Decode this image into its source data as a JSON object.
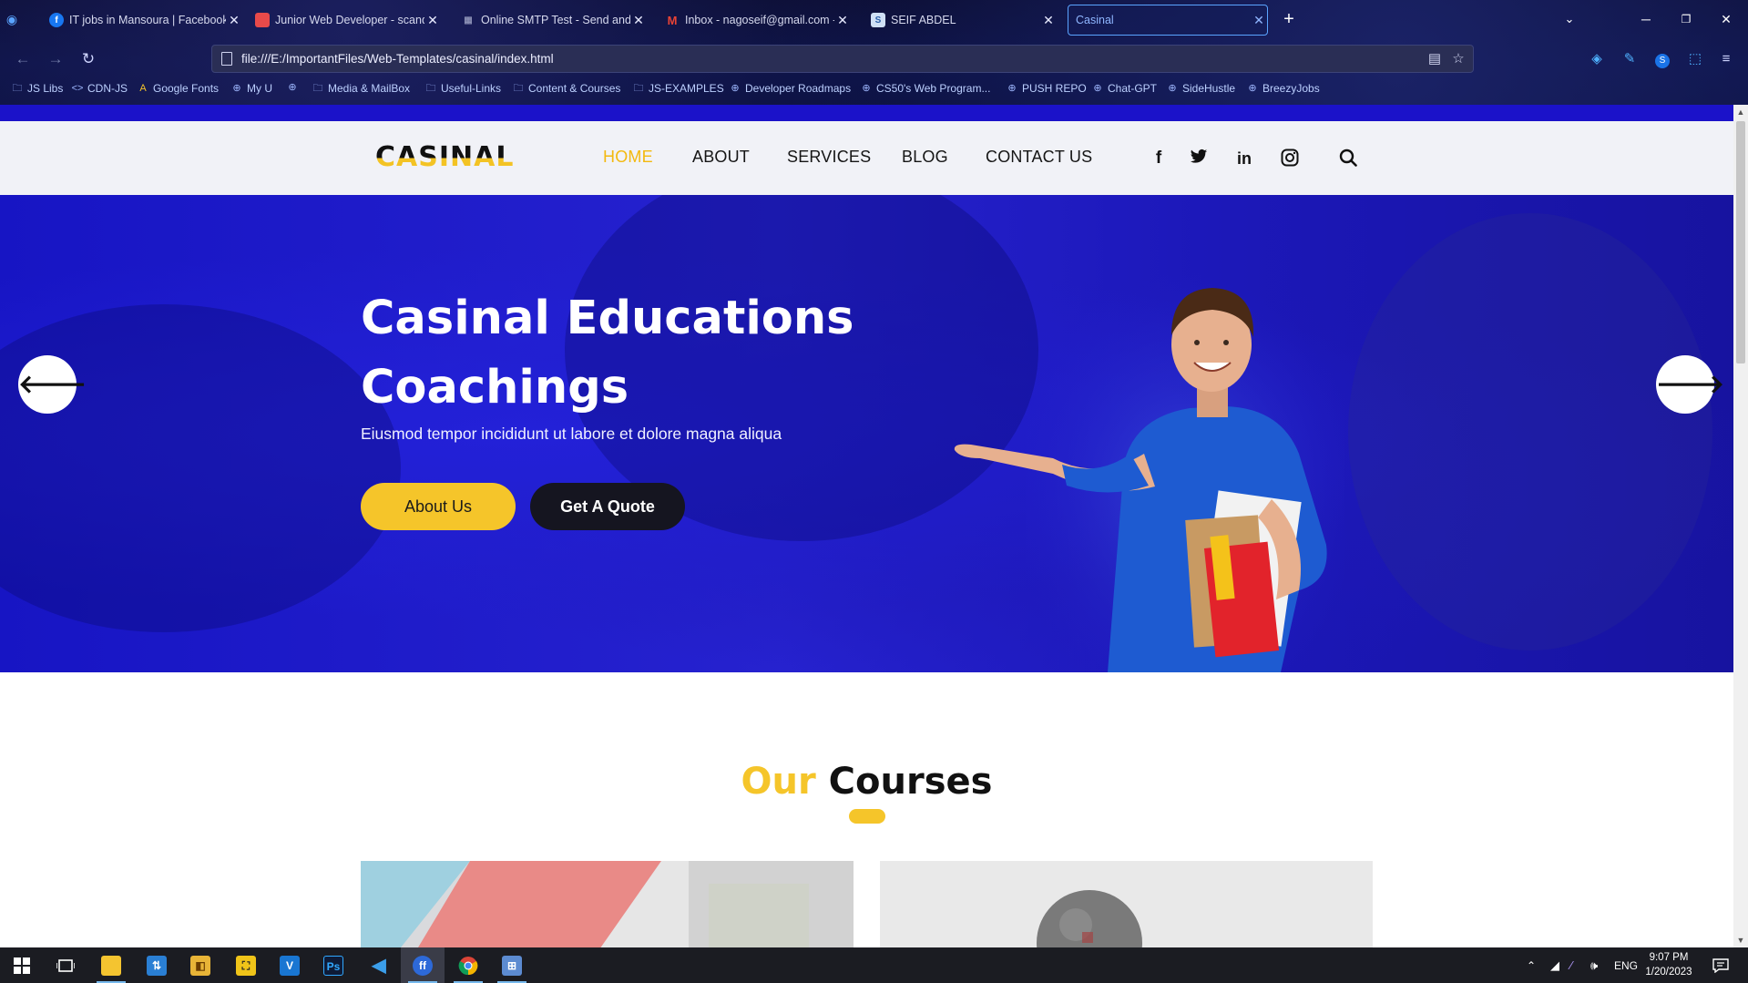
{
  "browser": {
    "tabs": [
      {
        "title": "IT jobs in Mansoura | Facebook",
        "favicon": "facebook-icon"
      },
      {
        "title": "Junior Web Developer - scandiweb",
        "favicon": "scandiweb-icon"
      },
      {
        "title": "Online SMTP Test - Send and Check",
        "favicon": "grid-icon"
      },
      {
        "title": "Inbox - nagoseif@gmail.com - Gmail",
        "favicon": "gmail-icon"
      },
      {
        "title": "SEIF ABDEL",
        "favicon": "page-icon"
      },
      {
        "title": "Casinal",
        "favicon": "none",
        "active": true
      }
    ],
    "url": "file:///E:/ImportantFiles/Web-Templates/casinal/index.html",
    "bookmarks": [
      {
        "label": "JS Libs",
        "icon": "folder-icon"
      },
      {
        "label": "CDN-JS",
        "icon": "code-icon"
      },
      {
        "label": "Google Fonts",
        "icon": "google-fonts-icon"
      },
      {
        "label": "My U",
        "icon": "globe-icon"
      },
      {
        "label": "",
        "icon": "globe-icon"
      },
      {
        "label": "Media & MailBox",
        "icon": "folder-icon"
      },
      {
        "label": "Useful-Links",
        "icon": "folder-icon"
      },
      {
        "label": "Content & Courses",
        "icon": "folder-icon"
      },
      {
        "label": "JS-EXAMPLES",
        "icon": "folder-icon"
      },
      {
        "label": "Developer Roadmaps",
        "icon": "globe-icon"
      },
      {
        "label": "CS50's Web Program...",
        "icon": "globe-icon"
      },
      {
        "label": "PUSH REPO",
        "icon": "globe-icon"
      },
      {
        "label": "Chat-GPT",
        "icon": "globe-icon"
      },
      {
        "label": "SideHustle",
        "icon": "globe-icon"
      },
      {
        "label": "BreezyJobs",
        "icon": "globe-icon"
      }
    ]
  },
  "site": {
    "logo": "CASINAL",
    "nav": [
      {
        "label": "HOME",
        "active": true
      },
      {
        "label": "ABOUT"
      },
      {
        "label": "SERVICES"
      },
      {
        "label": "BLOG"
      },
      {
        "label": "CONTACT US"
      }
    ],
    "social": [
      "facebook-icon",
      "twitter-icon",
      "linkedin-icon",
      "instagram-icon",
      "search-icon"
    ],
    "hero": {
      "title_line1": "Casinal Educations",
      "title_line2": "Coachings",
      "subtitle": "Eiusmod tempor incididunt ut labore et dolore magna aliqua",
      "btn_about": "About Us",
      "btn_quote": "Get A Quote"
    },
    "courses": {
      "title_highlight": "Our",
      "title_rest": "Courses"
    }
  },
  "taskbar": {
    "apps": [
      "windows-start-icon",
      "task-view-icon",
      "file-explorer-icon",
      "app-icon",
      "app-icon",
      "app-icon",
      "app-icon",
      "photoshop-icon",
      "vscode-icon",
      "firefox-icon",
      "chrome-icon",
      "app-icon"
    ],
    "tray_lang": "ENG",
    "time": "9:07 PM",
    "date": "1/20/2023"
  },
  "colors": {
    "accent": "#f5c52a",
    "hero_blue": "#2622cf",
    "nav_active": "#f3b90f"
  }
}
